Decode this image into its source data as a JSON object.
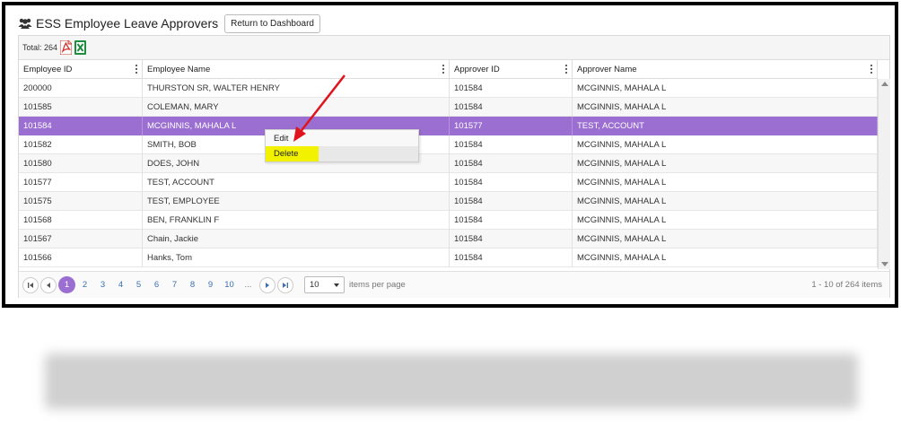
{
  "page": {
    "title": "ESS Employee Leave Approvers",
    "return_button": "Return to Dashboard",
    "icons": {
      "title_icon": "users-icon",
      "pdf": "pdf-export-icon",
      "excel": "excel-export-icon"
    }
  },
  "toolbar": {
    "total_label": "Total: 264"
  },
  "columns": [
    "Employee ID",
    "Employee Name",
    "Approver ID",
    "Approver Name"
  ],
  "rows": [
    {
      "employee_id": "200000",
      "employee_name": "THURSTON SR, WALTER HENRY",
      "approver_id": "101584",
      "approver_name": "MCGINNIS, MAHALA L"
    },
    {
      "employee_id": "101585",
      "employee_name": "COLEMAN, MARY",
      "approver_id": "101584",
      "approver_name": "MCGINNIS, MAHALA L"
    },
    {
      "employee_id": "101584",
      "employee_name": "MCGINNIS, MAHALA L",
      "approver_id": "101577",
      "approver_name": "TEST, ACCOUNT"
    },
    {
      "employee_id": "101582",
      "employee_name": "SMITH, BOB",
      "approver_id": "101584",
      "approver_name": "MCGINNIS, MAHALA L"
    },
    {
      "employee_id": "101580",
      "employee_name": "DOES, JOHN",
      "approver_id": "101584",
      "approver_name": "MCGINNIS, MAHALA L"
    },
    {
      "employee_id": "101577",
      "employee_name": "TEST, ACCOUNT",
      "approver_id": "101584",
      "approver_name": "MCGINNIS, MAHALA L"
    },
    {
      "employee_id": "101575",
      "employee_name": "TEST, EMPLOYEE",
      "approver_id": "101584",
      "approver_name": "MCGINNIS, MAHALA L"
    },
    {
      "employee_id": "101568",
      "employee_name": "BEN, FRANKLIN F",
      "approver_id": "101584",
      "approver_name": "MCGINNIS, MAHALA L"
    },
    {
      "employee_id": "101567",
      "employee_name": "Chain, Jackie",
      "approver_id": "101584",
      "approver_name": "MCGINNIS, MAHALA L"
    },
    {
      "employee_id": "101566",
      "employee_name": "Hanks, Tom",
      "approver_id": "101584",
      "approver_name": "MCGINNIS, MAHALA L"
    }
  ],
  "selected_row_index": 2,
  "context_menu": {
    "items": [
      "Edit",
      "Delete"
    ],
    "highlighted": "Delete"
  },
  "pager": {
    "pages": [
      "1",
      "2",
      "3",
      "4",
      "5",
      "6",
      "7",
      "8",
      "9",
      "10",
      "..."
    ],
    "current": "1",
    "page_size": "10",
    "items_per_page_label": "items per page",
    "range_label": "1 - 10 of 264 items"
  },
  "colors": {
    "accent": "#9b6fd1",
    "highlight": "#f2f200",
    "annotation_arrow": "#e0141e"
  }
}
